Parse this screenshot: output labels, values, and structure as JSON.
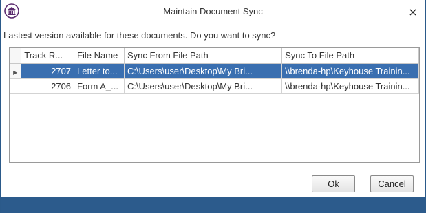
{
  "window": {
    "title": "Maintain Document Sync",
    "close_label": "×",
    "app_icon": "institution-icon"
  },
  "prompt": "Lastest version available for these documents. Do you want to sync?",
  "grid": {
    "columns": [
      "Track R...",
      "File Name",
      "Sync From File Path",
      "Sync To File Path"
    ],
    "rows": [
      {
        "track": "2707",
        "file_name": "Letter to...",
        "from": "C:\\Users\\user\\Desktop\\My Bri...",
        "to": "\\\\brenda-hp\\Keyhouse Trainin...",
        "selected": true
      },
      {
        "track": "2706",
        "file_name": "Form A_...",
        "from": "C:\\Users\\user\\Desktop\\My Bri...",
        "to": "\\\\brenda-hp\\Keyhouse Trainin...",
        "selected": false
      }
    ]
  },
  "buttons": {
    "ok": {
      "mnemonic": "O",
      "rest": "k"
    },
    "cancel": {
      "mnemonic": "C",
      "rest": "ancel"
    }
  },
  "colors": {
    "selection": "#3a6fb0",
    "bottom_band": "#2c5b8c"
  }
}
